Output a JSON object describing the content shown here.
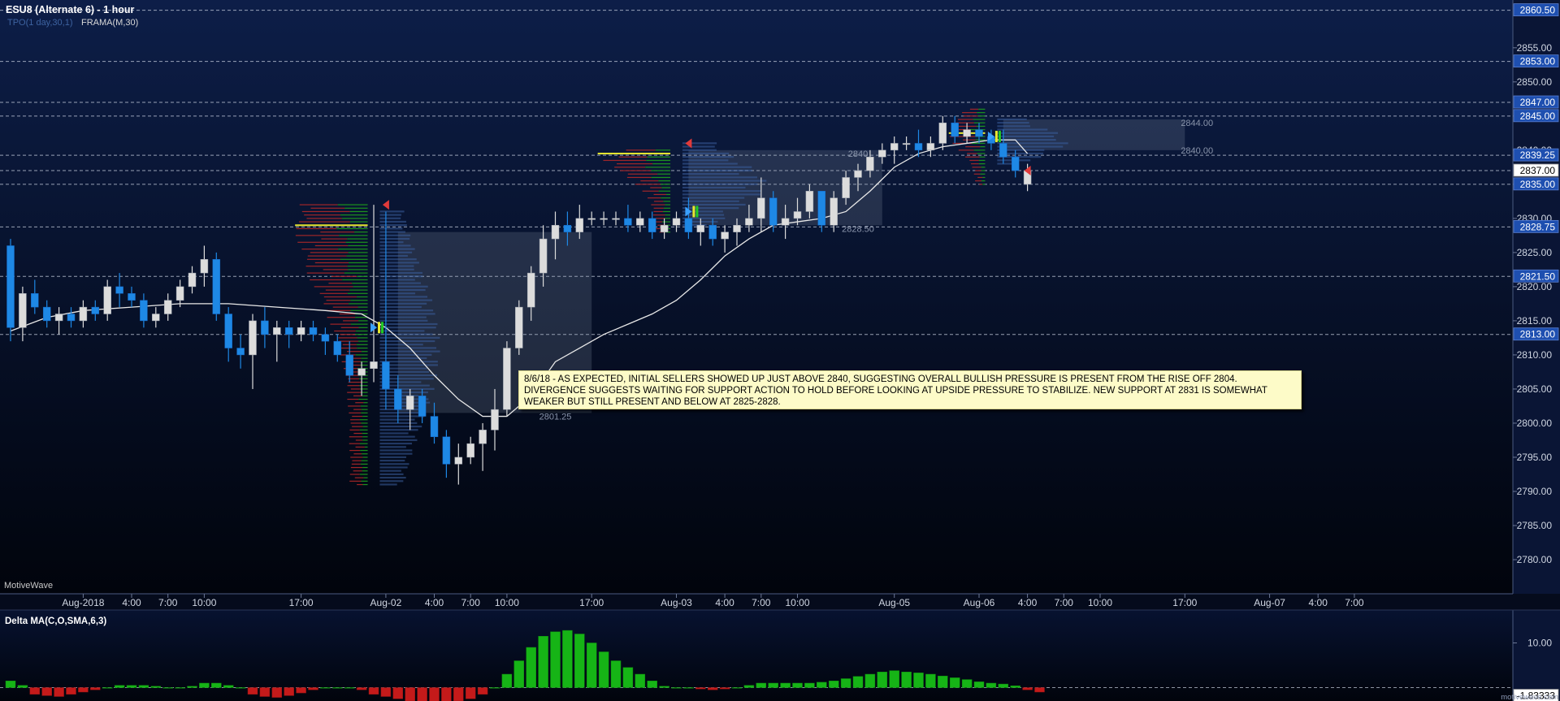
{
  "header": {
    "title": "ESU8 (Alternate 6) - 1 hour",
    "indicator_tpo": "TPO(1 day,30,1)",
    "indicator_frama": "FRAMA(M,30)"
  },
  "brand_watermark": "MotiveWave",
  "footer_url": "motivewave.com",
  "lower_panel": {
    "title": "Delta MA(C,O,SMA,6,3)"
  },
  "annotation": {
    "text": "8/6/18 -  AS EXPECTED, INITIAL SELLERS SHOWED UP JUST ABOVE 2840, SUGGESTING OVERALL BULLISH PRESSURE IS PRESENT FROM THE RISE OFF 2804. DIVERGENCE SUGGESTS WAITING FOR SUPPORT ACTION TO HOLD BEFORE LOOKING AT UPSIDE PRESSURE TO STABILIZE.  NEW SUPPORT AT 2831 IS SOMEWHAT WEAKER BUT STILL PRESENT AND BELOW AT 2825-2828."
  },
  "colors": {
    "bg_top": "#0d1e48",
    "bg_bottom": "#01040c",
    "up_candle": "#dcdcdc",
    "down_candle": "#1e88e5",
    "delta_positive": "#16b416",
    "delta_negative": "#c41a1a",
    "frama_line": "#e8e8e8",
    "price_box": "#1e4fb0",
    "current_box": "#ffffff"
  },
  "chart_data": [
    {
      "type": "candlestick",
      "symbol": "ESU8",
      "interval": "1 hour",
      "ylim": [
        2775,
        2862
      ],
      "y_ticks": [
        "2780.00",
        "2785.00",
        "2790.00",
        "2795.00",
        "2800.00",
        "2805.00",
        "2810.00",
        "2815.00",
        "2820.00",
        "2825.00",
        "2830.00",
        "2835.00",
        "2840.00",
        "2845.00",
        "2850.00",
        "2855.00"
      ],
      "x_labels": [
        "Aug-2018",
        "4:00",
        "7:00",
        "10:00",
        "17:00",
        "Aug-02",
        "4:00",
        "7:00",
        "10:00",
        "17:00",
        "Aug-03",
        "4:00",
        "7:00",
        "10:00",
        "Aug-05",
        "Aug-06",
        "4:00",
        "7:00",
        "10:00",
        "17:00",
        "Aug-07",
        "4:00",
        "7:00"
      ],
      "x_label_slots": [
        6,
        10,
        13,
        16,
        24,
        31,
        35,
        38,
        41,
        48,
        55,
        59,
        62,
        65,
        73,
        80,
        84,
        87,
        90,
        97,
        104,
        108,
        111
      ],
      "level_lines": [
        2860.5,
        2853.0,
        2847.0,
        2845.0,
        2839.25,
        2837.0,
        2835.0,
        2828.75,
        2821.5,
        2813.0
      ],
      "price_boxes": [
        {
          "label": "2860.50",
          "value": 2860.5
        },
        {
          "label": "2853.00",
          "value": 2853.0
        },
        {
          "label": "2847.00",
          "value": 2847.0
        },
        {
          "label": "2845.00",
          "value": 2845.0
        },
        {
          "label": "2839.25",
          "value": 2839.25
        },
        {
          "label": "2837.00",
          "value": 2837.0
        },
        {
          "label": "2835.00",
          "value": 2835.0
        },
        {
          "label": "2828.75",
          "value": 2828.75
        },
        {
          "label": "2821.50",
          "value": 2821.5
        },
        {
          "label": "2813.00",
          "value": 2813.0
        }
      ],
      "current_price": 2837.0,
      "value_area_labels": [
        {
          "text": "2844.00",
          "slot": 98,
          "value": 2844.0
        },
        {
          "text": "2840.00",
          "slot": 98,
          "value": 2840.0
        },
        {
          "text": "2840",
          "slot": 70,
          "value": 2839.5
        },
        {
          "text": "2828.50",
          "slot": 70,
          "value": 2828.5
        },
        {
          "text": "2801.25",
          "slot": 45,
          "value": 2801.0
        }
      ],
      "value_areas": [
        {
          "slot_start": 32,
          "slot_end": 48,
          "top": 2828.0,
          "bottom": 2801.5
        },
        {
          "slot_start": 56,
          "slot_end": 72,
          "top": 2840.0,
          "bottom": 2829.0
        },
        {
          "slot_start": 82,
          "slot_end": 97,
          "top": 2844.5,
          "bottom": 2840.0
        }
      ],
      "candles": [
        [
          2826,
          2827,
          2812,
          2814
        ],
        [
          2814,
          2820,
          2812,
          2819
        ],
        [
          2819,
          2821,
          2816,
          2817
        ],
        [
          2817,
          2818,
          2814,
          2815
        ],
        [
          2815,
          2817,
          2813,
          2816
        ],
        [
          2816,
          2817,
          2814,
          2815
        ],
        [
          2815,
          2818,
          2814,
          2817
        ],
        [
          2817,
          2818,
          2815,
          2816
        ],
        [
          2816,
          2821,
          2815,
          2820
        ],
        [
          2820,
          2822,
          2817,
          2819
        ],
        [
          2819,
          2820,
          2817,
          2818
        ],
        [
          2818,
          2819,
          2814,
          2815
        ],
        [
          2815,
          2817,
          2814,
          2816
        ],
        [
          2816,
          2819,
          2815,
          2818
        ],
        [
          2818,
          2821,
          2817,
          2820
        ],
        [
          2820,
          2823,
          2819,
          2822
        ],
        [
          2822,
          2826,
          2820,
          2824
        ],
        [
          2824,
          2825,
          2815,
          2816
        ],
        [
          2816,
          2817,
          2809,
          2811
        ],
        [
          2811,
          2813,
          2808,
          2810
        ],
        [
          2810,
          2816,
          2805,
          2815
        ],
        [
          2815,
          2817,
          2811,
          2813
        ],
        [
          2813,
          2815,
          2809,
          2814
        ],
        [
          2814,
          2815,
          2811,
          2813
        ],
        [
          2813,
          2815,
          2812,
          2814
        ],
        [
          2814,
          2815,
          2812,
          2813
        ],
        [
          2813,
          2814,
          2810,
          2812
        ],
        [
          2812,
          2813,
          2809,
          2810
        ],
        [
          2810,
          2812,
          2806,
          2807
        ],
        [
          2807,
          2809,
          2804,
          2808
        ],
        [
          2808,
          2832,
          2806,
          2809
        ],
        [
          2809,
          2831,
          2802,
          2805
        ],
        [
          2805,
          2807,
          2800,
          2802
        ],
        [
          2802,
          2805,
          2799,
          2804
        ],
        [
          2804,
          2805,
          2800,
          2801
        ],
        [
          2801,
          2803,
          2797,
          2798
        ],
        [
          2798,
          2799,
          2792,
          2794
        ],
        [
          2794,
          2797,
          2791,
          2795
        ],
        [
          2795,
          2798,
          2794,
          2797
        ],
        [
          2797,
          2800,
          2793,
          2799
        ],
        [
          2799,
          2805,
          2796,
          2802
        ],
        [
          2802,
          2812,
          2801,
          2811
        ],
        [
          2811,
          2818,
          2810,
          2817
        ],
        [
          2817,
          2823,
          2815,
          2822
        ],
        [
          2822,
          2829,
          2820,
          2827
        ],
        [
          2827,
          2831,
          2824,
          2829
        ],
        [
          2829,
          2831,
          2826,
          2828
        ],
        [
          2828,
          2832,
          2827,
          2830
        ],
        [
          2830,
          2831,
          2829,
          2830
        ],
        [
          2830,
          2831,
          2829,
          2830
        ],
        [
          2830,
          2831,
          2829,
          2830
        ],
        [
          2830,
          2832,
          2828,
          2829
        ],
        [
          2829,
          2831,
          2828,
          2830
        ],
        [
          2830,
          2831,
          2827,
          2828
        ],
        [
          2828,
          2830,
          2827,
          2829
        ],
        [
          2829,
          2831,
          2828,
          2830
        ],
        [
          2830,
          2833,
          2827,
          2828
        ],
        [
          2828,
          2830,
          2826,
          2829
        ],
        [
          2829,
          2830,
          2826,
          2827
        ],
        [
          2827,
          2829,
          2825,
          2828
        ],
        [
          2828,
          2830,
          2826,
          2829
        ],
        [
          2829,
          2832,
          2828,
          2830
        ],
        [
          2830,
          2836,
          2828,
          2833
        ],
        [
          2833,
          2834,
          2828,
          2829
        ],
        [
          2829,
          2832,
          2827,
          2830
        ],
        [
          2830,
          2833,
          2829,
          2831
        ],
        [
          2831,
          2835,
          2830,
          2834
        ],
        [
          2834,
          2834,
          2828,
          2829
        ],
        [
          2829,
          2834,
          2828,
          2833
        ],
        [
          2833,
          2837,
          2832,
          2836
        ],
        [
          2836,
          2838,
          2834,
          2837
        ],
        [
          2837,
          2840,
          2836,
          2839
        ],
        [
          2839,
          2841,
          2838,
          2840
        ],
        [
          2840,
          2842,
          2838,
          2841
        ],
        [
          2841,
          2842,
          2840,
          2841
        ],
        [
          2841,
          2843,
          2839,
          2840
        ],
        [
          2840,
          2842,
          2839,
          2841
        ],
        [
          2841,
          2845,
          2840,
          2844
        ],
        [
          2844,
          2845,
          2841,
          2842
        ],
        [
          2842,
          2844,
          2841,
          2843
        ],
        [
          2843,
          2844,
          2841,
          2842
        ],
        [
          2842,
          2843,
          2840,
          2841
        ],
        [
          2841,
          2843,
          2838,
          2839
        ],
        [
          2839,
          2840,
          2836,
          2837
        ],
        [
          2835,
          2838,
          2834,
          2837
        ]
      ],
      "frama": [
        [
          0,
          2813.5
        ],
        [
          3,
          2815.5
        ],
        [
          6,
          2816.5
        ],
        [
          10,
          2817
        ],
        [
          14,
          2817.5
        ],
        [
          18,
          2817.5
        ],
        [
          22,
          2817
        ],
        [
          26,
          2816.5
        ],
        [
          29,
          2816
        ],
        [
          31,
          2814
        ],
        [
          33,
          2811
        ],
        [
          35,
          2807
        ],
        [
          37,
          2803.5
        ],
        [
          39,
          2801
        ],
        [
          41,
          2801
        ],
        [
          43,
          2804
        ],
        [
          45,
          2809
        ],
        [
          47,
          2811
        ],
        [
          49,
          2813
        ],
        [
          51,
          2814.5
        ],
        [
          53,
          2816
        ],
        [
          55,
          2818
        ],
        [
          57,
          2821
        ],
        [
          59,
          2824.5
        ],
        [
          61,
          2827
        ],
        [
          63,
          2829
        ],
        [
          65,
          2829.5
        ],
        [
          67,
          2830
        ],
        [
          69,
          2831
        ],
        [
          71,
          2834
        ],
        [
          73,
          2837.5
        ],
        [
          75,
          2839.5
        ],
        [
          77,
          2840.5
        ],
        [
          79,
          2841
        ],
        [
          81,
          2841.5
        ],
        [
          83,
          2841.5
        ],
        [
          84,
          2839.5
        ]
      ],
      "markers": [
        {
          "type": "down",
          "slot": 31,
          "value": 2832
        },
        {
          "type": "up",
          "slot": 30,
          "value": 2814
        },
        {
          "type": "down",
          "slot": 56,
          "value": 2841
        },
        {
          "type": "up",
          "slot": 56,
          "value": 2831
        },
        {
          "type": "up",
          "slot": 81,
          "value": 2842
        },
        {
          "type": "down",
          "slot": 84,
          "value": 2837
        }
      ],
      "volume_profiles": [
        {
          "slot_end": 29.5,
          "slot_width": 6,
          "top": 2832,
          "bottom": 2791,
          "poc": 2829
        },
        {
          "slot_end": 54.5,
          "slot_width": 6,
          "top": 2840,
          "bottom": 2828,
          "poc": 2839.5
        },
        {
          "slot_end": 80.5,
          "slot_width": 3,
          "top": 2846,
          "bottom": 2835,
          "poc": 2842.5
        }
      ],
      "tpo_profiles": [
        {
          "slot_start": 30.5,
          "slot_width": 5,
          "top": 2831,
          "bottom": 2791
        },
        {
          "slot_start": 55.5,
          "slot_width": 7,
          "top": 2841,
          "bottom": 2829
        },
        {
          "slot_start": 81.5,
          "slot_width": 6,
          "top": 2844.5,
          "bottom": 2838
        }
      ]
    },
    {
      "type": "bar",
      "title": "Delta MA(C,O,SMA,6,3)",
      "ylim": [
        -3,
        17
      ],
      "y_ticks": [
        "10.00"
      ],
      "current_value_label": "-1.83333",
      "current_value": -1.8333,
      "values": [
        1.5,
        0.5,
        -1.5,
        -1.8,
        -2,
        -1.5,
        -1,
        -0.5,
        0,
        0.5,
        0.5,
        0.5,
        0.3,
        0,
        0,
        0.3,
        1,
        1,
        0.5,
        0,
        -1.5,
        -2,
        -2.2,
        -1.8,
        -1.2,
        -0.5,
        0,
        0,
        0,
        -0.5,
        -1.5,
        -2,
        -2.5,
        -3,
        -3.3,
        -3.5,
        -3.3,
        -3,
        -2.5,
        -1.5,
        0,
        3,
        6,
        9,
        11.5,
        12.5,
        12.8,
        12,
        10,
        8,
        6,
        4.5,
        3,
        1.5,
        0.3,
        0,
        0,
        -0.3,
        -0.5,
        -0.3,
        0,
        0.5,
        1,
        1,
        1,
        1,
        1,
        1.2,
        1.5,
        2,
        2.5,
        3,
        3.5,
        3.8,
        3.5,
        3.3,
        3,
        2.6,
        2.2,
        1.8,
        1.3,
        1,
        0.8,
        0.4,
        -0.5,
        -1
      ]
    }
  ]
}
